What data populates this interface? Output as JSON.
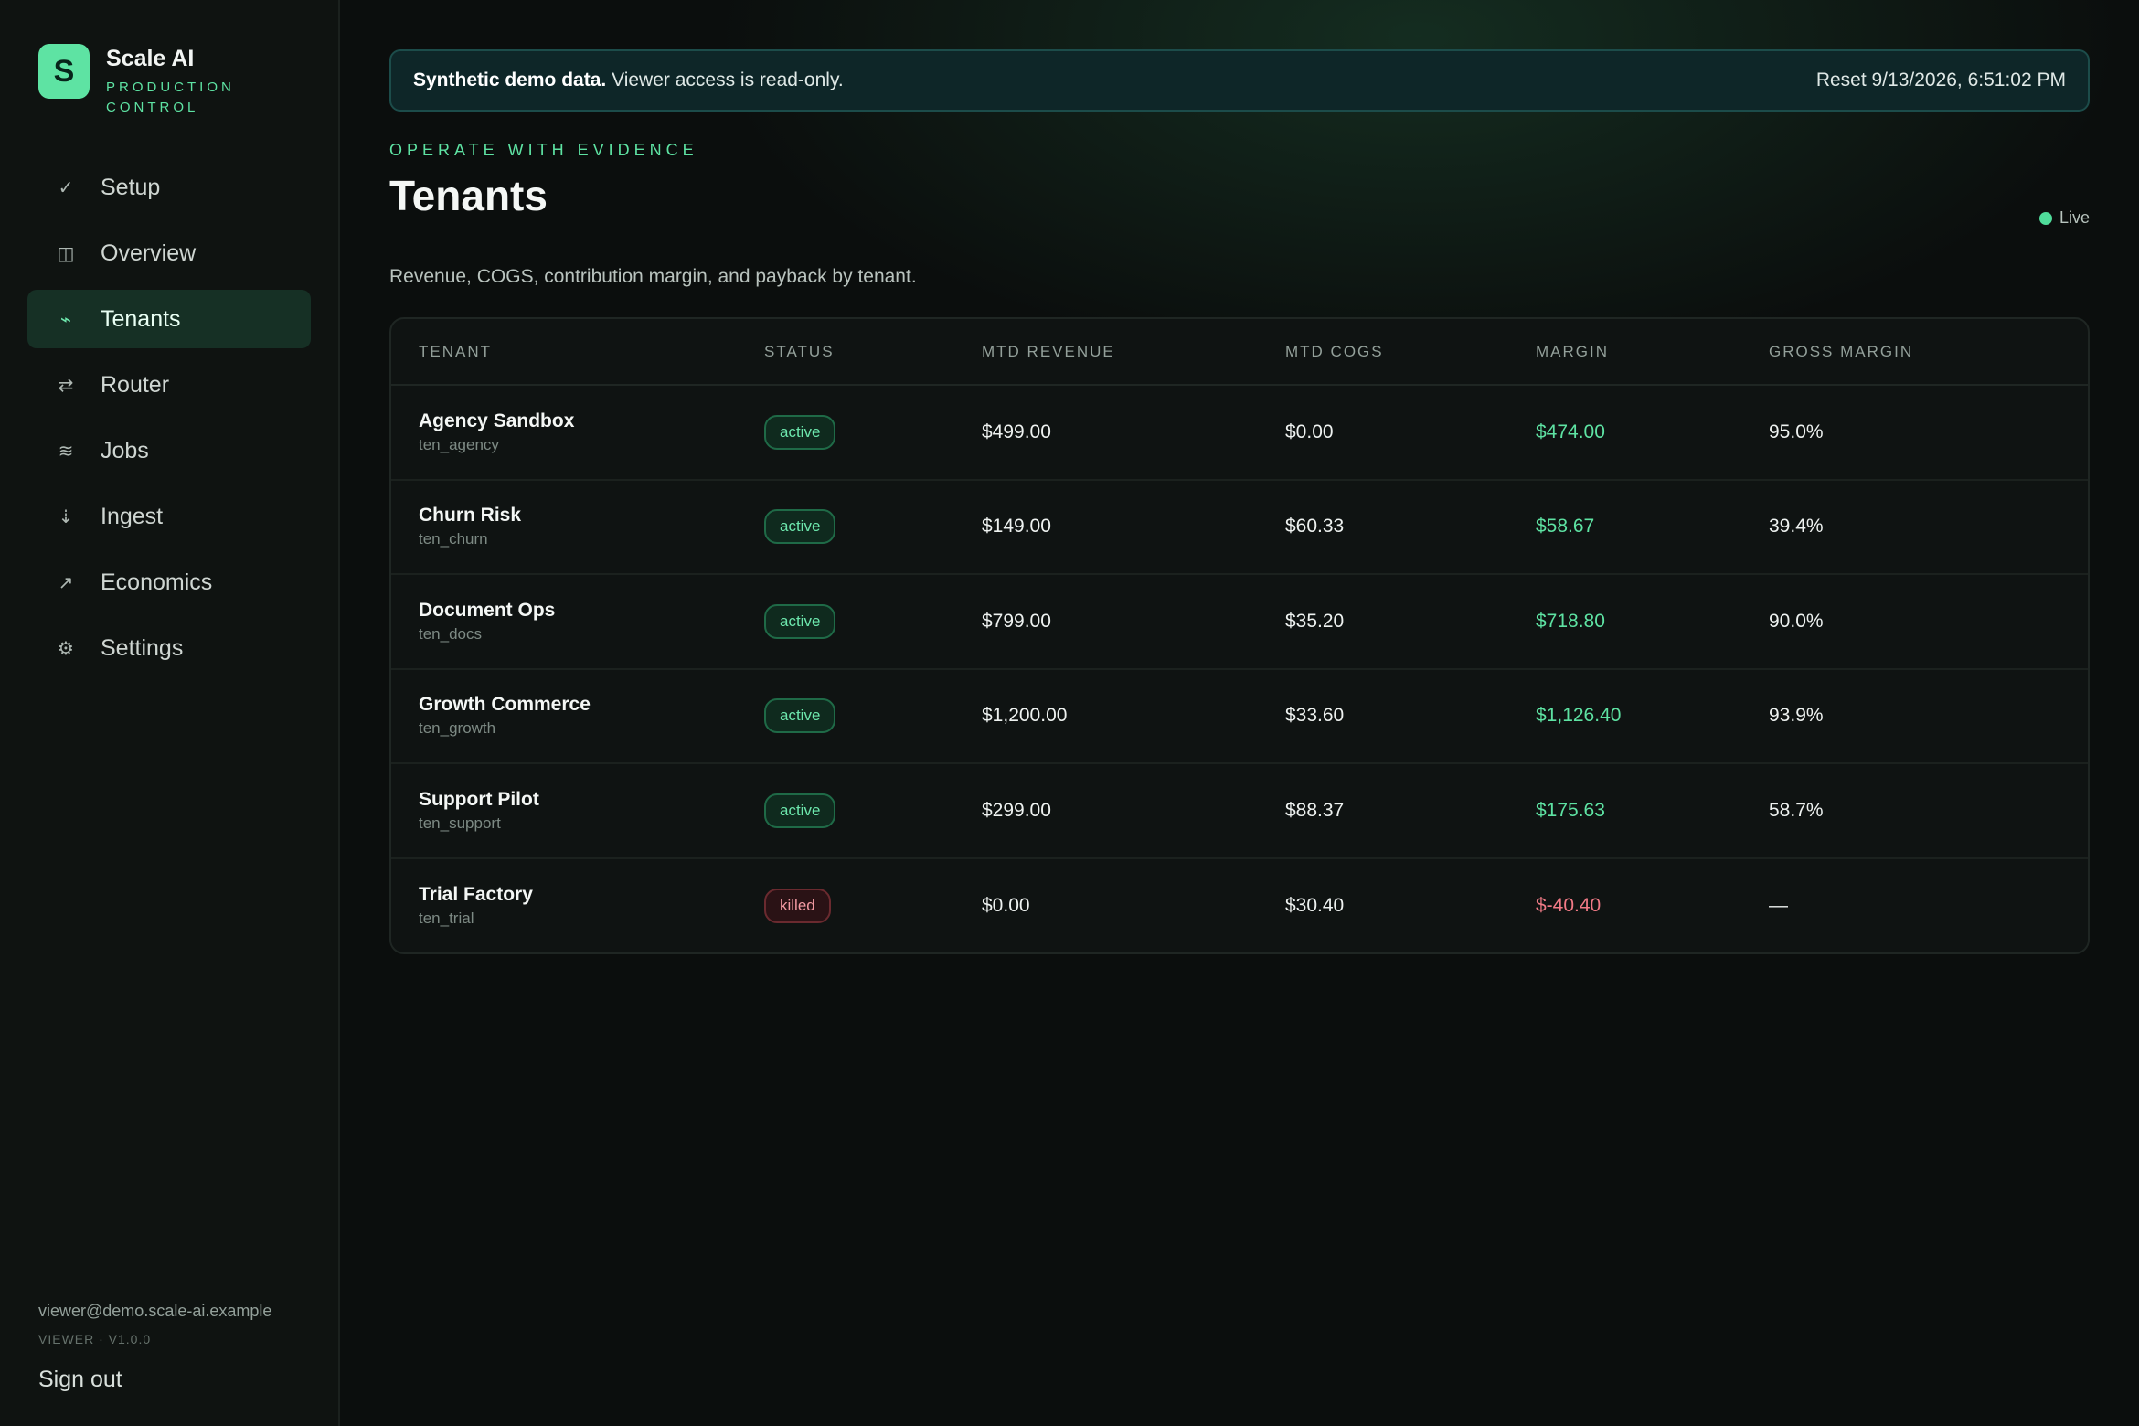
{
  "brand": {
    "logo_letter": "S",
    "name": "Scale AI",
    "subtitle": "PRODUCTION CONTROL"
  },
  "nav": {
    "items": [
      {
        "label": "Setup",
        "icon": "check-icon",
        "glyph": "✓"
      },
      {
        "label": "Overview",
        "icon": "columns-icon",
        "glyph": "◫"
      },
      {
        "label": "Tenants",
        "icon": "activity-icon",
        "glyph": "⌁",
        "active": true
      },
      {
        "label": "Router",
        "icon": "swap-icon",
        "glyph": "⇄"
      },
      {
        "label": "Jobs",
        "icon": "stack-icon",
        "glyph": "≋"
      },
      {
        "label": "Ingest",
        "icon": "download-icon",
        "glyph": "⇣"
      },
      {
        "label": "Economics",
        "icon": "trend-up-icon",
        "glyph": "↗"
      },
      {
        "label": "Settings",
        "icon": "gear-icon",
        "glyph": "⚙"
      }
    ]
  },
  "user": {
    "email": "viewer@demo.scale-ai.example",
    "role_version": "VIEWER · V1.0.0",
    "signout_label": "Sign out"
  },
  "banner": {
    "strong": "Synthetic demo data.",
    "text": "Viewer access is read-only.",
    "reset": "Reset 9/13/2026, 6:51:02 PM"
  },
  "page": {
    "eyebrow": "OPERATE WITH EVIDENCE",
    "title": "Tenants",
    "live_label": "Live",
    "subtitle": "Revenue, COGS, contribution margin, and payback by tenant."
  },
  "table": {
    "headers": [
      "TENANT",
      "STATUS",
      "MTD REVENUE",
      "MTD COGS",
      "MARGIN",
      "GROSS MARGIN"
    ],
    "rows": [
      {
        "name": "Agency Sandbox",
        "id": "ten_agency",
        "status": "active",
        "revenue": "$499.00",
        "cogs": "$0.00",
        "margin": "$474.00",
        "gross": "95.0%"
      },
      {
        "name": "Churn Risk",
        "id": "ten_churn",
        "status": "active",
        "revenue": "$149.00",
        "cogs": "$60.33",
        "margin": "$58.67",
        "gross": "39.4%"
      },
      {
        "name": "Document Ops",
        "id": "ten_docs",
        "status": "active",
        "revenue": "$799.00",
        "cogs": "$35.20",
        "margin": "$718.80",
        "gross": "90.0%"
      },
      {
        "name": "Growth Commerce",
        "id": "ten_growth",
        "status": "active",
        "revenue": "$1,200.00",
        "cogs": "$33.60",
        "margin": "$1,126.40",
        "gross": "93.9%"
      },
      {
        "name": "Support Pilot",
        "id": "ten_support",
        "status": "active",
        "revenue": "$299.00",
        "cogs": "$88.37",
        "margin": "$175.63",
        "gross": "58.7%"
      },
      {
        "name": "Trial Factory",
        "id": "ten_trial",
        "status": "killed",
        "revenue": "$0.00",
        "cogs": "$30.40",
        "margin": "$-40.40",
        "gross": "—"
      }
    ]
  },
  "colors": {
    "accent": "#5ee3a3",
    "negative": "#f07a86",
    "active_nav_bg": "#163025"
  }
}
